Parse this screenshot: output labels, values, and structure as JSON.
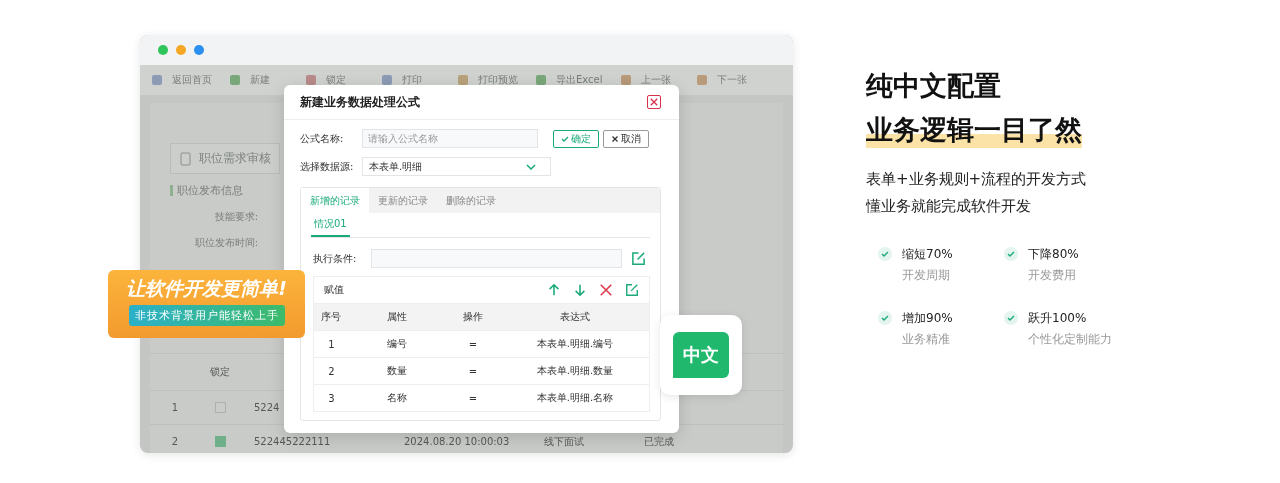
{
  "app_window": {
    "toolbar": [
      {
        "label": "返回首页",
        "kind": "home"
      },
      {
        "label": "新建",
        "kind": "doc"
      },
      {
        "label": "锁定",
        "kind": "lock"
      },
      {
        "label": "打印",
        "kind": "print"
      },
      {
        "label": "打印预览",
        "kind": "preview"
      },
      {
        "label": "导出Excel",
        "kind": "excel"
      },
      {
        "label": "上一张",
        "kind": "prev"
      },
      {
        "label": "下一张",
        "kind": "next"
      }
    ],
    "task_button": "职位需求审核",
    "section_title": "职位发布信息",
    "field_labels": [
      "技能要求:",
      "职位发布时间:"
    ],
    "table": {
      "columns": [
        "锁定"
      ],
      "rows": [
        {
          "index": "1",
          "checked": false,
          "column_3": "5224"
        },
        {
          "index": "2",
          "checked": true,
          "column_3": "522445222111",
          "column_4": "2024.08.20 10:00:03",
          "column_5": "线下面试",
          "column_6": "已完成"
        }
      ]
    }
  },
  "dialog": {
    "title": "新建业务数据处理公式",
    "name_label": "公式名称:",
    "name_placeholder": "请输入公式名称",
    "confirm": "确定",
    "cancel": "取消",
    "source_label": "选择数据源:",
    "source_value": "本表单.明细",
    "tabs": [
      {
        "label": "新增的记录",
        "selected": true
      },
      {
        "label": "更新的记录",
        "selected": false
      },
      {
        "label": "删除的记录",
        "selected": false
      }
    ],
    "subtabs": [
      {
        "label": "情况01",
        "selected": true
      }
    ],
    "condition_label": "执行条件:",
    "assign_title": "赋值",
    "columns": [
      "序号",
      "属性",
      "操作",
      "表达式"
    ],
    "rows": [
      [
        "1",
        "编号",
        "=",
        "本表单.明细.编号"
      ],
      [
        "2",
        "数量",
        "=",
        "本表单.明细.数量"
      ],
      [
        "3",
        "名称",
        "=",
        "本表单.明细.名称"
      ]
    ]
  },
  "badge": {
    "title": "让软件开发更简单!",
    "subtitle": "非技术背景用户能轻松上手"
  },
  "chat_icon_text": "中文",
  "headline": [
    {
      "text": "纯中文配置",
      "highlighted": false
    },
    {
      "text": "业务逻辑一目了然",
      "highlighted": true
    }
  ],
  "description": [
    "表单+业务规则+流程的开发方式",
    "懂业务就能完成软件开发"
  ],
  "stats": [
    {
      "value": "缩短70%",
      "label": "开发周期"
    },
    {
      "value": "下降80%",
      "label": "开发费用"
    },
    {
      "value": "增加90%",
      "label": "业务精准"
    },
    {
      "value": "跃升100%",
      "label": "个性化定制能力"
    }
  ]
}
